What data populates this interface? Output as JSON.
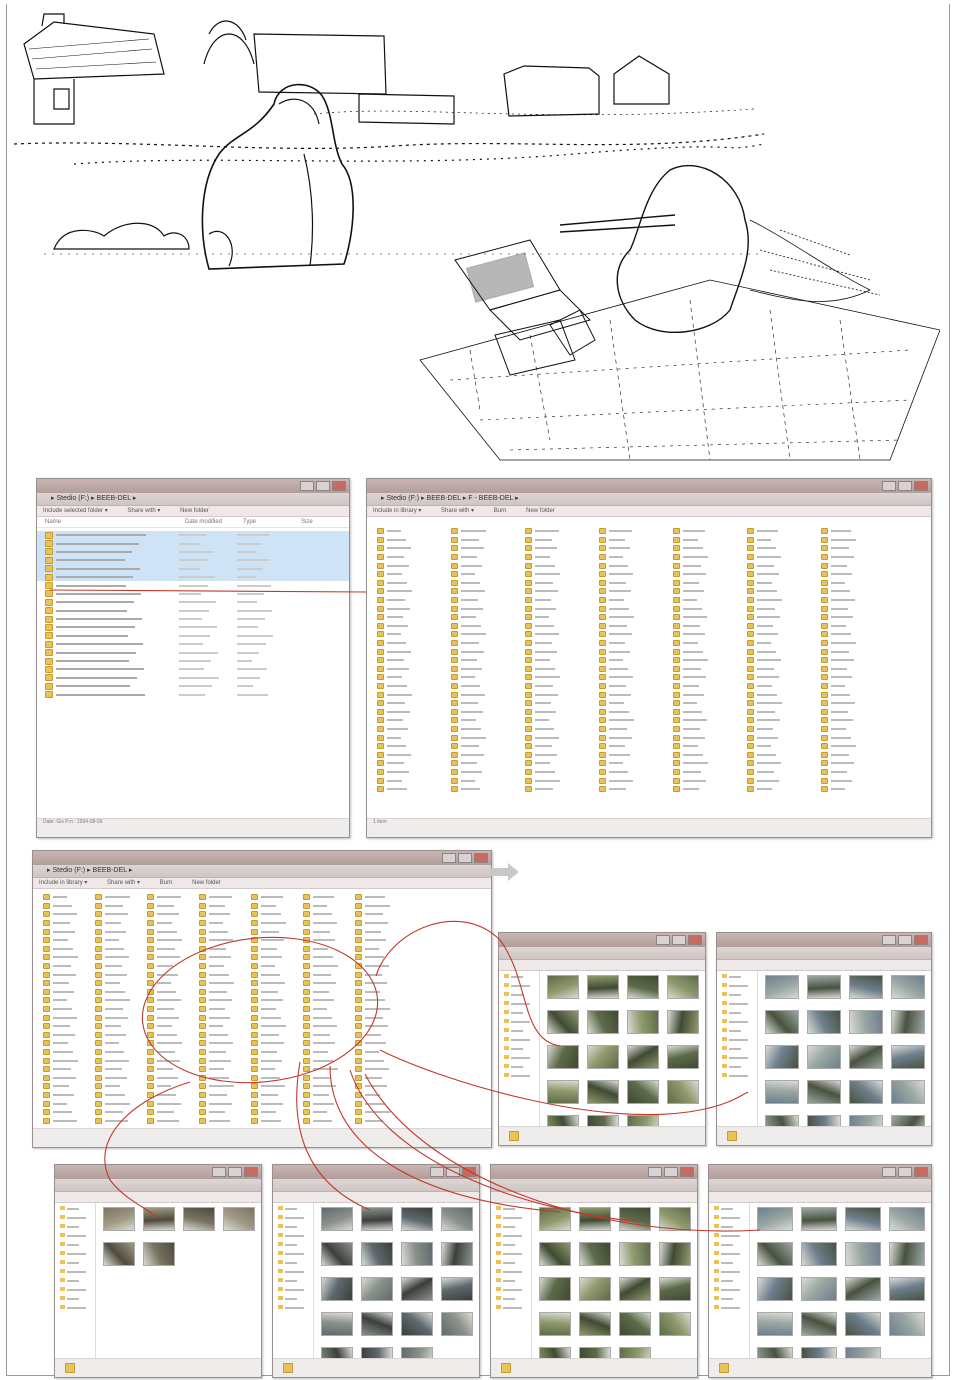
{
  "windows": {
    "w1": {
      "address": "▸ Stedio (F:) ▸ BEEB-DEL ▸",
      "toolbar": [
        "Include selected folder ▾",
        "Share with ▾",
        "New folder"
      ],
      "columns": [
        "Name",
        "Date modified",
        "Type",
        "Size"
      ],
      "status": "Date: Gis P:n : 1994-08-09"
    },
    "w2": {
      "address": "▸ Stedio (F:) ▸ BEEB-DEL ▸ F - BEEB-DEL ▸",
      "toolbar": [
        "Include in library ▾",
        "Share with ▾",
        "Burn",
        "New folder"
      ],
      "status": "1 item"
    },
    "w3": {
      "address": "▸ Stedio (F:) ▸ BEEB-DEL ▸",
      "toolbar": [
        "Include in library ▾",
        "Share with ▾",
        "Burn",
        "New folder"
      ],
      "status": ""
    }
  },
  "colors": {
    "accent_curve": "#c0392b",
    "folder": "#e9c25a",
    "titlebar": "#b8a4a1",
    "selection": "#cfe3f7"
  },
  "icons": [
    "folder-icon",
    "arrow-right-icon",
    "minimize-icon",
    "maximize-icon",
    "close-icon"
  ]
}
